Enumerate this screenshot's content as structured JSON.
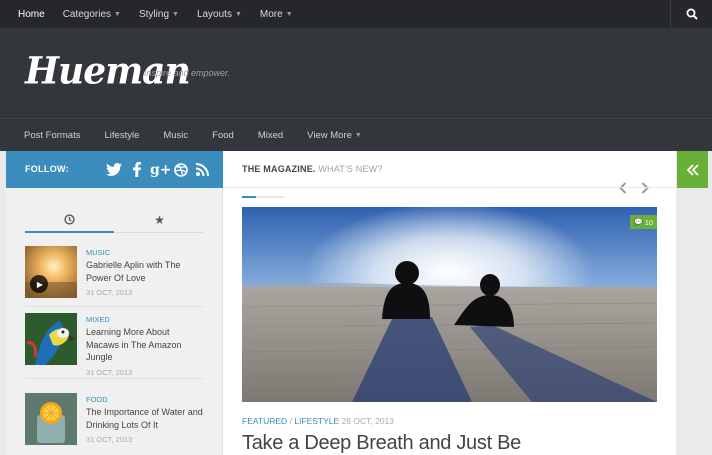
{
  "topnav": {
    "items": [
      {
        "label": "Home",
        "dropdown": false
      },
      {
        "label": "Categories",
        "dropdown": true
      },
      {
        "label": "Styling",
        "dropdown": true
      },
      {
        "label": "Layouts",
        "dropdown": true
      },
      {
        "label": "More",
        "dropdown": true
      }
    ],
    "search_icon": "search-icon"
  },
  "header": {
    "logo": "Hueman",
    "tagline": "Inspire and empower."
  },
  "subnav": {
    "items": [
      {
        "label": "Post Formats"
      },
      {
        "label": "Lifestyle"
      },
      {
        "label": "Music"
      },
      {
        "label": "Food"
      },
      {
        "label": "Mixed"
      },
      {
        "label": "View More",
        "dropdown": true
      }
    ]
  },
  "sidebar": {
    "follow_label": "FOLLOW:",
    "social_icons": [
      "twitter-icon",
      "facebook-icon",
      "google-plus-icon",
      "dribbble-icon",
      "rss-icon"
    ],
    "tabs": [
      "clock-icon",
      "star-icon"
    ],
    "posts": [
      {
        "category": "MUSIC",
        "title": "Gabrielle Aplin with The Power Of Love",
        "date": "31 OCT, 2013",
        "has_play": true
      },
      {
        "category": "MIXED",
        "title": "Learning More About Macaws in The Amazon Jungle",
        "date": "31 OCT, 2013",
        "has_play": false
      },
      {
        "category": "FOOD",
        "title": "The Importance of Water and Drinking Lots Of It",
        "date": "31 OCT, 2013",
        "has_play": false
      }
    ]
  },
  "main": {
    "magazine_title": "THE MAGAZINE.",
    "magazine_subtitle": "WHAT'S NEW?",
    "comments_count": "10",
    "category_1": "FEATURED",
    "category_sep": "/",
    "category_2": "LIFESTYLE",
    "date": "28 OCT, 2013",
    "post_title": "Take a Deep Breath and Just Be"
  },
  "colors": {
    "accent_blue": "#3b8dbd",
    "accent_green": "#68b038",
    "dark_nav": "#26272b",
    "header_bg": "#33363b"
  }
}
